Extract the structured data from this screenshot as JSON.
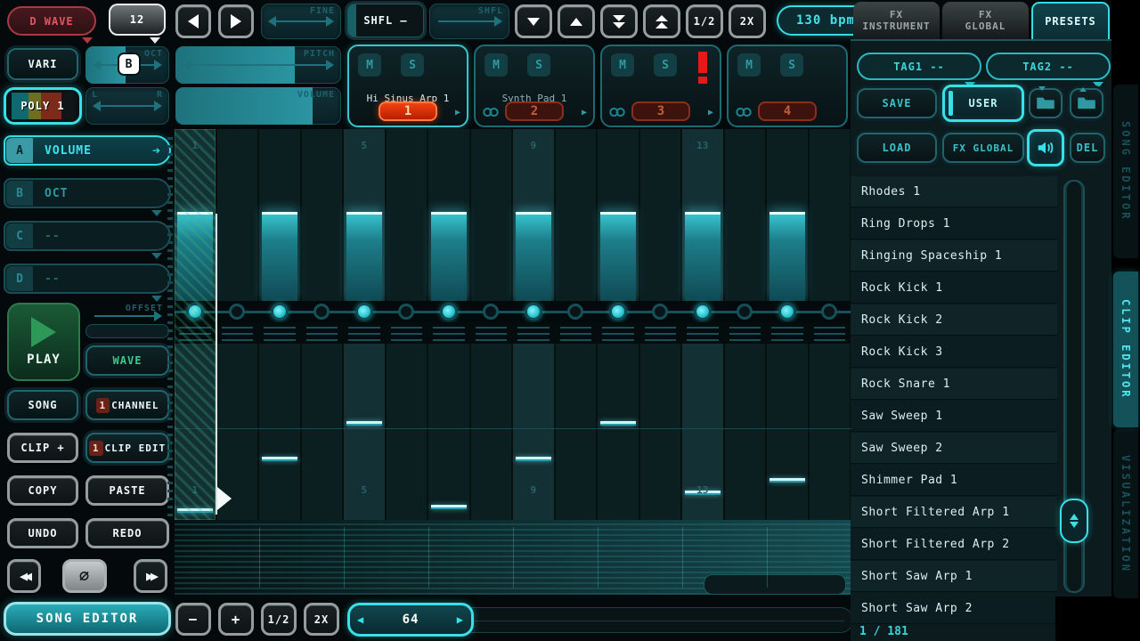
{
  "colors": {
    "accent": "#3ae0e8",
    "dim_teal": "#1d6a72",
    "red": "#e05050",
    "badge_red": "#e03a10",
    "green": "#2e9858",
    "bpm_cyan": "#45e0e8"
  },
  "top_bar": {
    "wave_select": "D WAVE",
    "wave_count": "12",
    "fine_label": "FINE",
    "shfl_toggle": "SHFL –",
    "shfl_label": "SHFL",
    "half": "1/2",
    "twox": "2X",
    "bpm": "130 bpm"
  },
  "top_tabs": {
    "fx_instrument_1": "FX",
    "fx_instrument_2": "INSTRUMENT",
    "fx_global_1": "FX",
    "fx_global_2": "GLOBAL",
    "presets": "PRESETS"
  },
  "mixer": {
    "vari": "VARI",
    "oct_label": "OCT",
    "oct_key": "B",
    "pitch_label": "PITCH",
    "poly": "POLY 1",
    "pan_l": "L",
    "pan_r": "R",
    "volume_label": "VOLUME"
  },
  "channels": [
    {
      "number": "1",
      "name": "Hi Sinus Arp 1",
      "mute": "M",
      "solo": "S",
      "selected": true,
      "alert": false
    },
    {
      "number": "2",
      "name": "Synth Pad 1",
      "mute": "M",
      "solo": "S",
      "selected": false,
      "alert": false
    },
    {
      "number": "3",
      "name": "",
      "mute": "M",
      "solo": "S",
      "selected": false,
      "alert": true
    },
    {
      "number": "4",
      "name": "",
      "mute": "M",
      "solo": "S",
      "selected": false,
      "alert": false
    }
  ],
  "lanes": [
    {
      "key": "A",
      "label": "VOLUME",
      "active": true
    },
    {
      "key": "B",
      "label": "OCT",
      "active": false
    },
    {
      "key": "C",
      "label": "--",
      "active": false
    },
    {
      "key": "D",
      "label": "--",
      "active": false
    }
  ],
  "transport": {
    "play": "PLAY",
    "offset_label": "OFFSET",
    "wave": "WAVE",
    "song": "SONG",
    "channel_num": "1",
    "channel": "CHANNEL",
    "clip_add": "CLIP +",
    "clip_edit_num": "1",
    "clip_edit": "CLIP EDIT",
    "copy": "COPY",
    "paste": "PASTE",
    "undo": "UNDO",
    "redo": "REDO",
    "reset": "∅",
    "song_editor": "SONG EDITOR"
  },
  "bottom_bar": {
    "minus": "−",
    "plus": "+",
    "half": "1/2",
    "twox": "2X",
    "length": "64"
  },
  "presets_panel": {
    "tag1": "TAG1 --",
    "tag2": "TAG2 --",
    "save": "SAVE",
    "user": "USER",
    "load": "LOAD",
    "fx_global": "FX GLOBAL",
    "del": "DEL",
    "items": [
      "Rhodes 1",
      "Ring Drops 1",
      "Ringing Spaceship 1",
      "Rock Kick 1",
      "Rock Kick 2",
      "Rock Kick 3",
      "Rock Snare 1",
      "Saw Sweep 1",
      "Saw Sweep 2",
      "Shimmer Pad 1",
      "Short Filtered Arp 1",
      "Short Filtered Arp 2",
      "Short Saw Arp 1",
      "Short Saw Arp 2"
    ],
    "count": "1 / 181"
  },
  "side_tabs": [
    {
      "label": "SONG EDITOR",
      "active": false
    },
    {
      "label": "CLIP EDITOR",
      "active": true
    },
    {
      "label": "VISUALIZATION",
      "active": false
    }
  ],
  "grid": {
    "steps": 16,
    "step_numbers": {
      "0": "1",
      "4": "5",
      "8": "9",
      "12": "13"
    },
    "volume_bars": [
      0.52,
      0,
      0.52,
      0,
      0.52,
      0,
      0.52,
      0,
      0.52,
      0,
      0.52,
      0,
      0.52,
      0,
      0.52,
      0
    ],
    "offset_dots": [
      1,
      0,
      1,
      0,
      1,
      0,
      1,
      0,
      1,
      0,
      1,
      0,
      1,
      0,
      1,
      0
    ],
    "oct_markers": [
      0.95,
      null,
      0.655,
      null,
      0.455,
      null,
      0.93,
      null,
      0.655,
      null,
      0.455,
      null,
      0.85,
      null,
      0.78,
      null
    ]
  }
}
